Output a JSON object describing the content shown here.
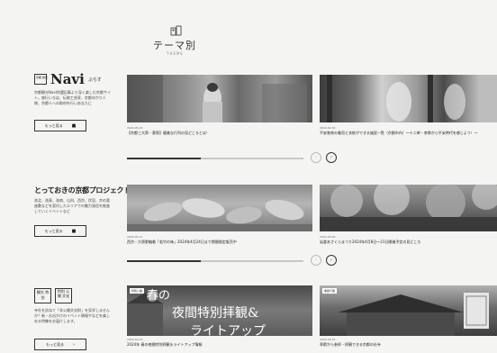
{
  "header": {
    "title": "テーマ別",
    "subtitle": "THEME"
  },
  "sections": [
    {
      "brand_box": "京都 観光",
      "brand_name": "Navi",
      "brand_small": "ぷらす",
      "description": "京都観光Navi特選記事より深く楽しむ京都サイト。旅行いろは、伝統工芸家、京都ゆかり人物、京都人への取材を行いあなたに",
      "more_label": "もっと見る",
      "cards": [
        {
          "date": "2024-05-15",
          "title": "【京都三大祭・葵祭】優美な行列の見どころとは！"
        },
        {
          "date": "2024-04-30",
          "title": "平安装束の着用と衣紋ができる施設一覧（京都市内）〜十二単・束帯から平安時代を感じよう！〜"
        }
      ]
    },
    {
      "brand_name": "とっておきの京都プロジェクト",
      "description": "洛北、洛東、洛南、山科、西京、伏見、京の奥座敷などを案内したエリアでの魅力発信を推進していくイベントなど",
      "more_label": "もっと見る",
      "cards": [
        {
          "date": "2024-04-11",
          "title": "西京・大原野編着「若竹の味」2024年4月24日まで期間限定販売中"
        },
        {
          "date": "2024-03-20",
          "title": "岩倉あさくらまつり2024年4月8日〜21日開催予定の見どころ"
        }
      ]
    },
    {
      "stamps": [
        "観光 特別",
        "特別 公開 文化"
      ],
      "description": "寺社を訪ねて「非公開文化財」を見学しませんか？新・お出かけのイベント情報やなどを楽しめる特集をお届けします。",
      "more_label": "もっと見る",
      "cards": [
        {
          "tag": "特別公開",
          "overlay_line1": "春の",
          "overlay_line2": "夜間特別拝観&",
          "overlay_line3": "ライトアップ",
          "date": "2024-03-13",
          "title": "2024年 春の夜間特別拝観＆ライトアップ情報"
        },
        {
          "tag": "季節行事",
          "date": "2024-03-13",
          "title": "季節から参拝・拝観できる京都の社寺"
        }
      ]
    }
  ],
  "slider": {
    "prev": "‹",
    "next": "›"
  },
  "progress": [
    0.42,
    0.42
  ]
}
